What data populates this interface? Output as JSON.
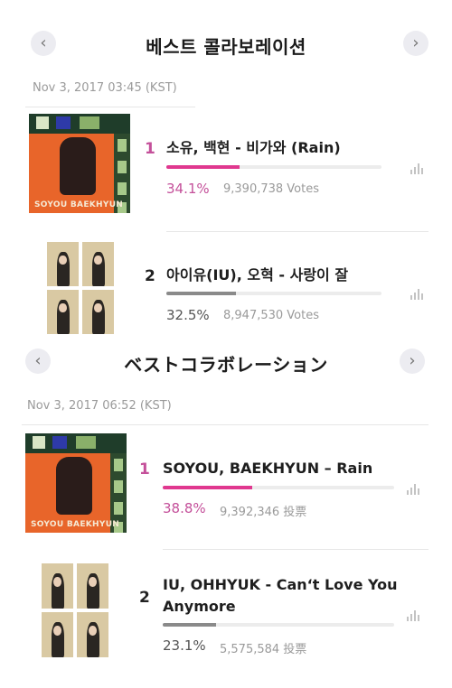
{
  "sections": [
    {
      "title": "베스트 콜라보레이션",
      "timestamp": "Nov 3, 2017 03:45 (KST)",
      "prev_icon": "‹",
      "next_icon": "›",
      "entries": [
        {
          "rank": "1",
          "song": "소유, 백현 - 비가와 (Rain)",
          "percent_text": "34.1%",
          "percent": 34.1,
          "votes": "9,390,738 Votes",
          "art": "soyou-baekhyun-rain-cover",
          "art_label": "SOYOU BAEKHYUN",
          "highlight": true
        },
        {
          "rank": "2",
          "song": "아이유(IU), 오혁 - 사랑이 잘",
          "percent_text": "32.5%",
          "percent": 32.5,
          "votes": "8,947,530 Votes",
          "art": "iu-ohhyuk-cover",
          "highlight": false
        }
      ]
    },
    {
      "title": "ベストコラボレーション",
      "timestamp": "Nov 3, 2017 06:52 (KST)",
      "prev_icon": "‹",
      "next_icon": "›",
      "entries": [
        {
          "rank": "1",
          "song": "SOYOU, BAEKHYUN – Rain",
          "percent_text": "38.8%",
          "percent": 38.8,
          "votes": "9,392,346 投票",
          "art": "soyou-baekhyun-rain-cover",
          "art_label": "SOYOU BAEKHYUN",
          "highlight": true
        },
        {
          "rank": "2",
          "song": "IU, OHHYUK - Can‘t Love You Anymore",
          "percent_text": "23.1%",
          "percent": 23.1,
          "votes": "5,575,584 投票",
          "art": "iu-ohhyuk-cover",
          "highlight": false
        }
      ]
    }
  ],
  "colors": {
    "accent": "#e0388f",
    "accent_text": "#c4509a",
    "muted_bar": "#8a8a8a",
    "muted_text": "#555555",
    "track": "#ececec"
  },
  "icons": {
    "chart": "bar-chart-icon"
  }
}
